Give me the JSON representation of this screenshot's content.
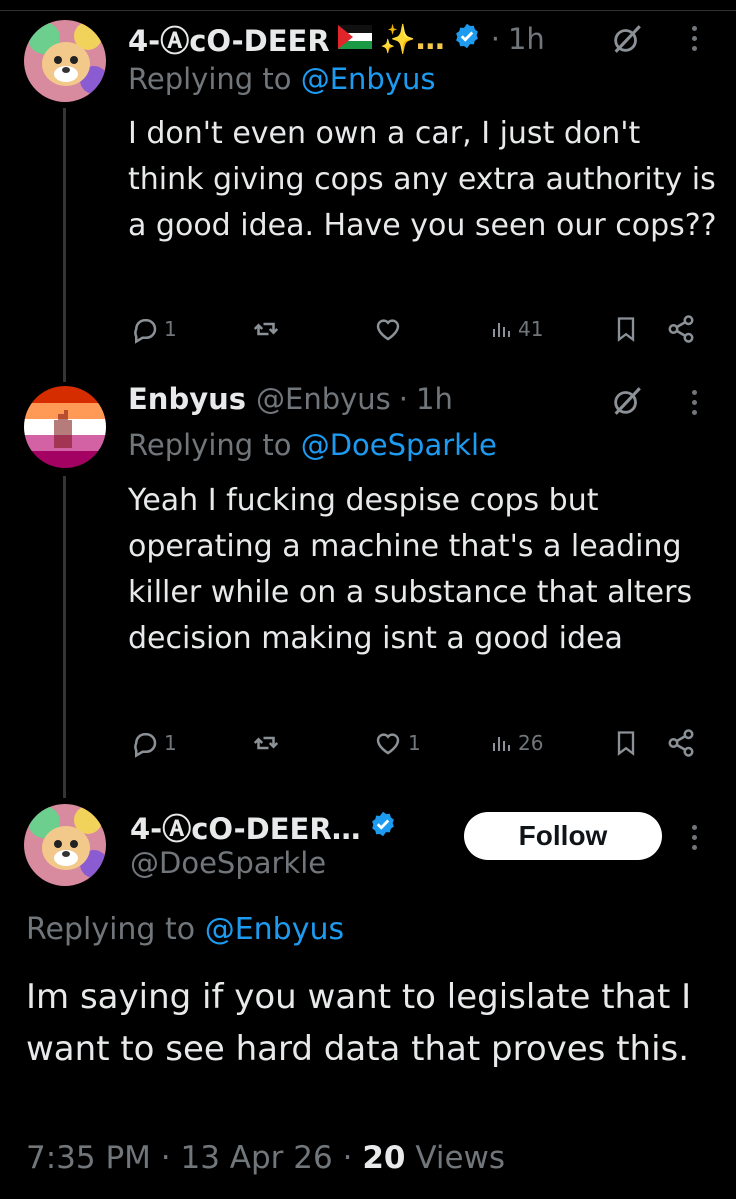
{
  "tweets": [
    {
      "display_name": "4-ⒶcO-DEER",
      "emoji": "✨…",
      "flag": "palestine-flag",
      "verified": true,
      "dot": "·",
      "time": "1h",
      "replying_prefix": "Replying to",
      "replying_handle": "@Enbyus",
      "text": "I don't even own a car, I just don't think giving cops any extra authority is a good idea. Have you seen our cops??",
      "stats": {
        "replies": "1",
        "reposts": "",
        "likes": "",
        "views": "41"
      }
    },
    {
      "display_name": "Enbyus",
      "handle": "@Enbyus",
      "dot": "·",
      "time": "1h",
      "replying_prefix": "Replying to",
      "replying_handle": "@DoeSparkle",
      "text": "Yeah I fucking despise cops but operating a machine that's a leading killer while on a substance that alters decision making isnt a good idea",
      "stats": {
        "replies": "1",
        "reposts": "",
        "likes": "1",
        "views": "26"
      }
    }
  ],
  "main_tweet": {
    "display_name": "4-ⒶcO-DEER…",
    "handle": "@DoeSparkle",
    "verified": true,
    "follow_label": "Follow",
    "replying_prefix": "Replying to",
    "replying_handle": "@Enbyus",
    "text": "Im saying if you want to legislate that I want to see hard data that proves this.",
    "time": "7:35 PM",
    "date": "13 Apr 26",
    "sep": "·",
    "views_count": "20",
    "views_label": "Views"
  },
  "colors": {
    "accent": "#1d9bf0",
    "muted": "#71767b",
    "text": "#e7e9ea",
    "background": "#000000"
  }
}
